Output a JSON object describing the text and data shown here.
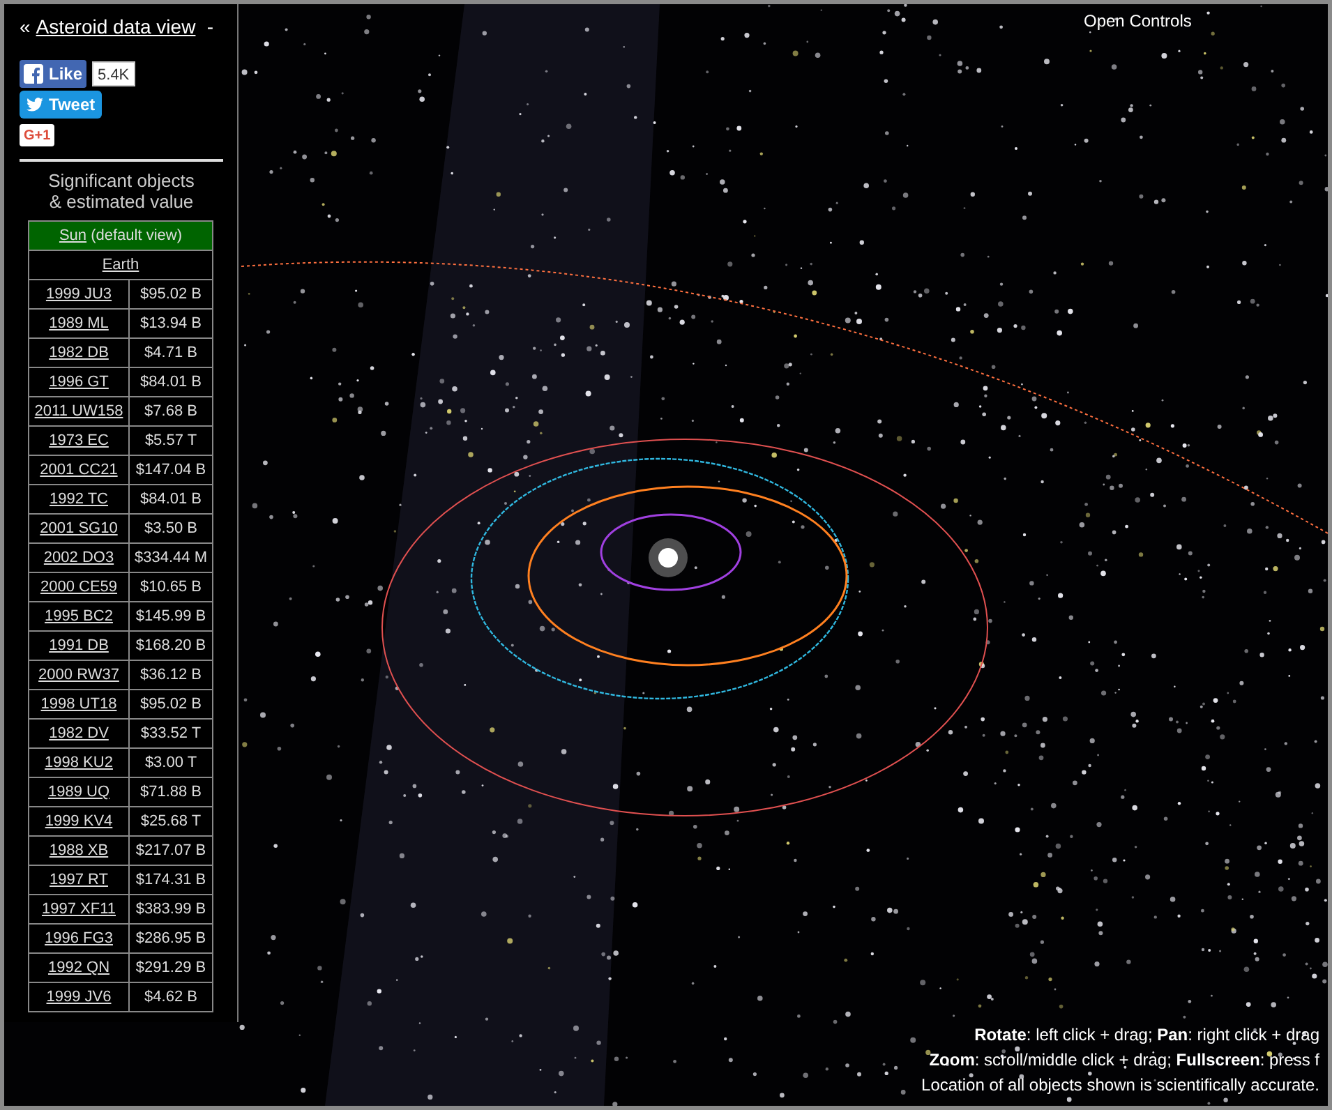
{
  "sidebar": {
    "back_mark": "«",
    "title": "Asteroid data view",
    "collapse": "-",
    "share": {
      "like": "Like",
      "like_count": "5.4K",
      "tweet": "Tweet",
      "plus_one": "G+1"
    },
    "heading": [
      "Significant objects",
      "& estimated value"
    ],
    "views": [
      {
        "name": "Sun",
        "note": "(default view)",
        "selected": true
      },
      {
        "name": "Earth",
        "selected": false
      }
    ],
    "objects": [
      {
        "name": "1999 JU3",
        "value": "$95.02 B"
      },
      {
        "name": "1989 ML",
        "value": "$13.94 B"
      },
      {
        "name": "1982 DB",
        "value": "$4.71 B"
      },
      {
        "name": "1996 GT",
        "value": "$84.01 B"
      },
      {
        "name": "2011 UW158",
        "value": "$7.68 B"
      },
      {
        "name": "1973 EC",
        "value": "$5.57 T"
      },
      {
        "name": "2001 CC21",
        "value": "$147.04 B"
      },
      {
        "name": "1992 TC",
        "value": "$84.01 B"
      },
      {
        "name": "2001 SG10",
        "value": "$3.50 B"
      },
      {
        "name": "2002 DO3",
        "value": "$334.44 M"
      },
      {
        "name": "2000 CE59",
        "value": "$10.65 B"
      },
      {
        "name": "1995 BC2",
        "value": "$145.99 B"
      },
      {
        "name": "1991 DB",
        "value": "$168.20 B"
      },
      {
        "name": "2000 RW37",
        "value": "$36.12 B"
      },
      {
        "name": "1998 UT18",
        "value": "$95.02 B"
      },
      {
        "name": "1982 DV",
        "value": "$33.52 T"
      },
      {
        "name": "1998 KU2",
        "value": "$3.00 T"
      },
      {
        "name": "1989 UQ",
        "value": "$71.88 B"
      },
      {
        "name": "1999 KV4",
        "value": "$25.68 T"
      },
      {
        "name": "1988 XB",
        "value": "$217.07 B"
      },
      {
        "name": "1997 RT",
        "value": "$174.31 B"
      },
      {
        "name": "1997 XF11",
        "value": "$383.99 B"
      },
      {
        "name": "1996 FG3",
        "value": "$286.95 B"
      },
      {
        "name": "1992 QN",
        "value": "$291.29 B"
      },
      {
        "name": "1999 JV6",
        "value": "$4.62 B"
      }
    ]
  },
  "controls_button": "Open Controls",
  "help": [
    "**Rotate**: left click + drag; **Pan**: right click + drag",
    "**Zoom**: scroll/middle click + drag; **Fullscreen**: press f",
    "Location of all objects shown is scientifically accurate."
  ]
}
